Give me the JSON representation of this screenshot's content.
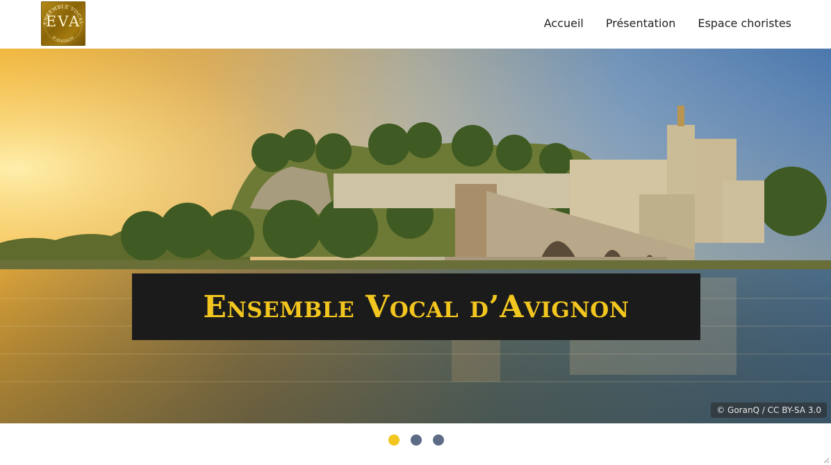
{
  "header": {
    "logo": {
      "monogram": "EVA",
      "ring_top": "ENSEMBLE VOCAL",
      "ring_bottom": "D'AVIGNON",
      "colors": {
        "gold": "#a47a0f",
        "text": "#fff6cf"
      }
    },
    "nav": [
      {
        "label": "Accueil"
      },
      {
        "label": "Présentation"
      },
      {
        "label": "Espace choristes"
      }
    ]
  },
  "hero": {
    "title": "Ensemble Vocal d’Avignon",
    "photo_credit": "© GoranQ / CC BY-SA 3.0",
    "colors": {
      "title_text": "#f2c61f",
      "title_bg": "#1c1b1b"
    }
  },
  "carousel": {
    "slide_count": 3,
    "active_index": 0,
    "colors": {
      "active": "#f2c61f",
      "inactive": "#5d6b86"
    }
  }
}
